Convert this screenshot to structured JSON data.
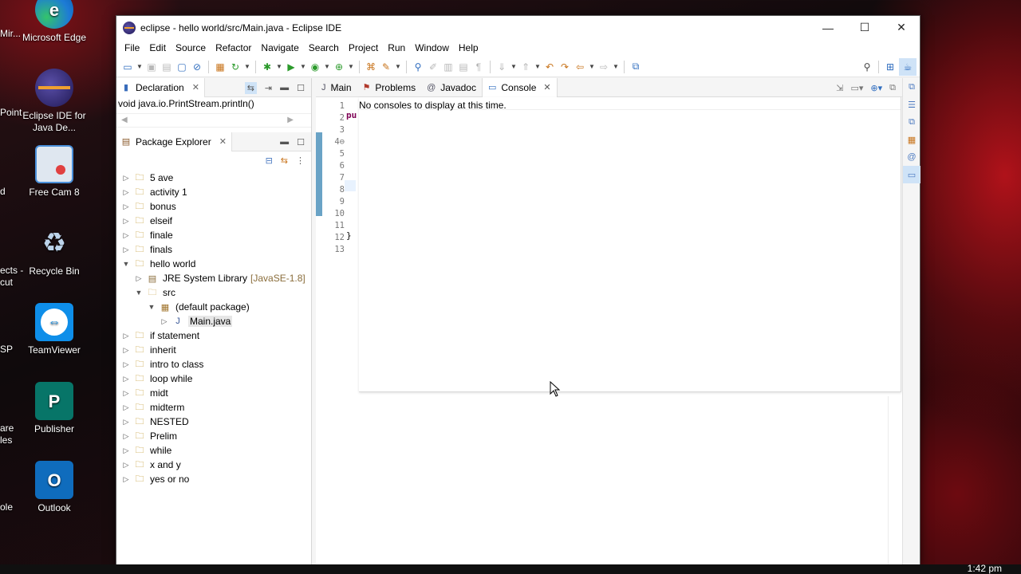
{
  "desktop": {
    "icons": [
      {
        "label": "Microsoft Edge",
        "icon": "edge-icon",
        "color": "#1d7bd6"
      },
      {
        "label": "Eclipse IDE for Java De...",
        "icon": "eclipse-icon",
        "color": "#2c2466"
      },
      {
        "label": "Free Cam 8",
        "icon": "freecam-icon",
        "color": "#4a8fd9"
      },
      {
        "label": "Recycle Bin",
        "icon": "recycle-bin-icon",
        "color": "#7fa8d0"
      },
      {
        "label": "TeamViewer",
        "icon": "teamviewer-icon",
        "color": "#0e8ee9"
      },
      {
        "label": "Publisher",
        "icon": "publisher-icon",
        "color": "#077568"
      },
      {
        "label": "Outlook",
        "icon": "outlook-icon",
        "color": "#0f6cbd"
      }
    ],
    "partial_labels": [
      "Mir...",
      "Point",
      "d",
      "ects -",
      "cut",
      "SP",
      "are",
      "les",
      "ole"
    ],
    "clock": "1:42 pm"
  },
  "window": {
    "title": "eclipse - hello world/src/Main.java - Eclipse IDE",
    "buttons": {
      "minimize": "—",
      "maximize": "☐",
      "close": "✕"
    }
  },
  "menu": [
    "File",
    "Edit",
    "Source",
    "Refactor",
    "Navigate",
    "Search",
    "Project",
    "Run",
    "Window",
    "Help"
  ],
  "declaration_view": {
    "tab_label": "Declaration",
    "content": "void java.io.PrintStream.println()"
  },
  "package_explorer": {
    "tab_label": "Package Explorer",
    "items": [
      {
        "label": "5 ave",
        "level": 0,
        "expanded": false,
        "type": "project"
      },
      {
        "label": "activity 1",
        "level": 0,
        "expanded": false,
        "type": "project"
      },
      {
        "label": "bonus",
        "level": 0,
        "expanded": false,
        "type": "project"
      },
      {
        "label": "elseif",
        "level": 0,
        "expanded": false,
        "type": "project"
      },
      {
        "label": "finale",
        "level": 0,
        "expanded": false,
        "type": "project"
      },
      {
        "label": "finals",
        "level": 0,
        "expanded": false,
        "type": "project"
      },
      {
        "label": "hello world",
        "level": 0,
        "expanded": true,
        "type": "project"
      },
      {
        "label": "JRE System Library",
        "extra": "[JavaSE-1.8]",
        "level": 1,
        "expanded": false,
        "type": "library"
      },
      {
        "label": "src",
        "level": 1,
        "expanded": true,
        "type": "folder"
      },
      {
        "label": "(default package)",
        "level": 2,
        "expanded": true,
        "type": "package"
      },
      {
        "label": "Main.java",
        "level": 3,
        "expanded": false,
        "type": "java",
        "selected": true
      },
      {
        "label": "if statement",
        "level": 0,
        "expanded": false,
        "type": "project"
      },
      {
        "label": "inherit",
        "level": 0,
        "expanded": false,
        "type": "project"
      },
      {
        "label": "intro to class",
        "level": 0,
        "expanded": false,
        "type": "project"
      },
      {
        "label": "loop while",
        "level": 0,
        "expanded": false,
        "type": "project"
      },
      {
        "label": "midt",
        "level": 0,
        "expanded": false,
        "type": "project"
      },
      {
        "label": "midterm",
        "level": 0,
        "expanded": false,
        "type": "project"
      },
      {
        "label": "NESTED",
        "level": 0,
        "expanded": false,
        "type": "project"
      },
      {
        "label": "Prelim",
        "level": 0,
        "expanded": false,
        "type": "project"
      },
      {
        "label": "while",
        "level": 0,
        "expanded": false,
        "type": "project"
      },
      {
        "label": "x and y",
        "level": 0,
        "expanded": false,
        "type": "project"
      },
      {
        "label": "yes or no",
        "level": 0,
        "expanded": false,
        "type": "project"
      }
    ]
  },
  "editor_tabs": [
    {
      "label": "Main",
      "icon": "java-file-icon"
    },
    {
      "label": "Problems",
      "icon": "problems-icon"
    },
    {
      "label": "Javadoc",
      "icon": "at-icon"
    },
    {
      "label": "Console",
      "icon": "console-icon",
      "active": true
    }
  ],
  "editor": {
    "line_numbers": [
      "1",
      "2",
      "3",
      "4⊖",
      "5",
      "6",
      "7",
      "8",
      "9",
      "10",
      "11",
      "12",
      "13"
    ],
    "line2_fragment": "pu",
    "line12_fragment": "}"
  },
  "console": {
    "message": "No consoles to display at this time."
  }
}
